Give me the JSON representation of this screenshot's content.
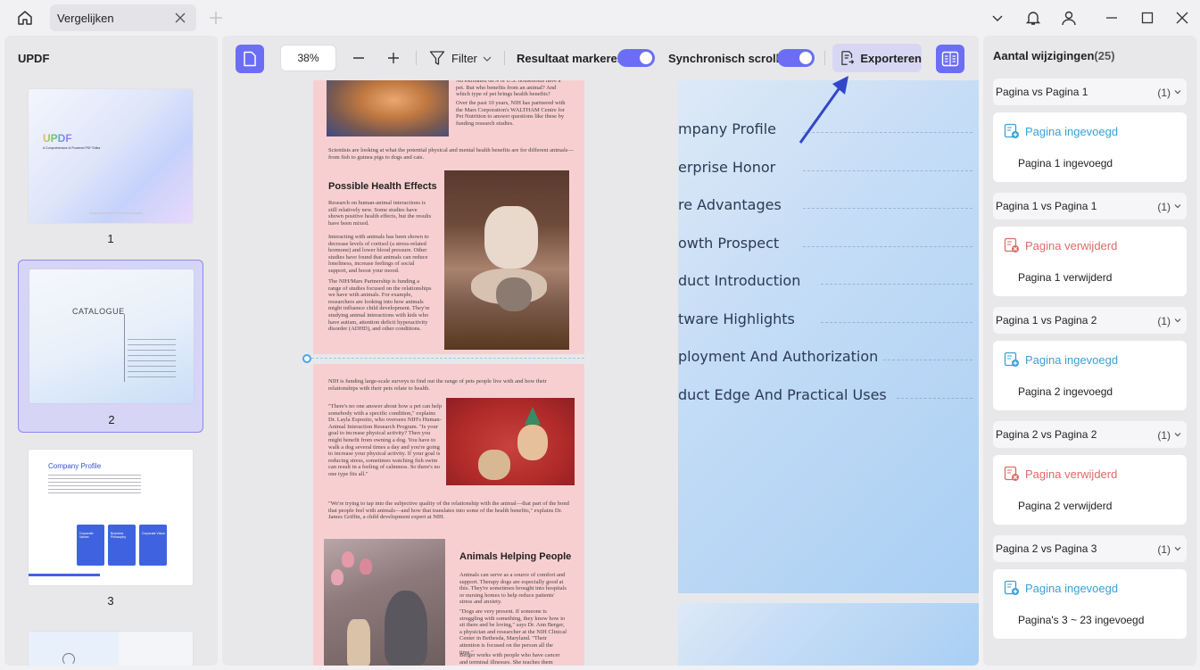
{
  "titlebar": {
    "tab_label": "Vergelijken"
  },
  "left_panel": {
    "title": "UPDF",
    "thumbnails": [
      {
        "number": "1",
        "logo": "UPDF",
        "subtitle": "A Comprehensive AI Powered PDF Editor"
      },
      {
        "number": "2",
        "heading": "CATALOGUE"
      },
      {
        "number": "3",
        "heading": "Company Profile",
        "cards": [
          "Corporate Values",
          "Business Philosophy",
          "Corporate Vision"
        ]
      }
    ]
  },
  "toolbar": {
    "zoom": "38%",
    "filter_label": "Filter",
    "highlight_label": "Resultaat markeren",
    "sync_label": "Synchronisch scrollen",
    "export_label": "Exporteren"
  },
  "left_document": {
    "page1": {
      "intro_top": "An estimated 68% of U.S. households have a pet. But who benefits from an animal? And which type of pet brings health benefits?",
      "intro_2": "Over the past 10 years, NIH has partnered with the Mars Corporation's WALTHAM Centre for Pet Nutrition to answer questions like these by funding research studies.",
      "intro_3": "Scientists are looking at what the potential physical and mental health benefits are for different animals—from fish to guinea pigs to dogs and cats.",
      "heading": "Possible Health Effects",
      "p1": "Research on human-animal interactions is still relatively new. Some studies have shown positive health effects, but the results have been mixed.",
      "p2": "Interacting with animals has been shown to decrease levels of cortisol (a stress-related hormone) and lower blood pressure. Other studies have found that animals can reduce loneliness, increase feelings of social support, and boost your mood.",
      "p3": "The NIH/Mars Partnership is funding a range of studies focused on the relationships we have with animals. For example, researchers are looking into how animals might influence child development. They're studying animal interactions with kids who have autism, attention deficit hyperactivity disorder (ADHD), and other conditions."
    },
    "page2": {
      "p1": "NIH is funding large-scale surveys to find out the range of pets people live with and how their relationships with their pets relate to health.",
      "p2": "\"There's no one answer about how a pet can help somebody with a specific condition,\" explains Dr. Layla Esposito, who oversees NIH's Human-Animal Interaction Research Program. \"Is your goal to increase physical activity? Then you might benefit from owning a dog. You have to walk a dog several times a day and you're going to increase your physical activity. If your goal is reducing stress, sometimes watching fish swim can result in a feeling of calmness. So there's no one type fits all.\"",
      "p3": "\"We're trying to tap into the subjective quality of the relationship with the animal—that part of the bond that people feel with animals—and how that translates into some of the health benefits,\" explains Dr. James Griffin, a child development expert at NIH.",
      "heading": "Animals Helping People",
      "p4": "Animals can serve as a source of comfort and support. Therapy dogs are especially good at this. They're sometimes brought into hospitals or nursing homes to help reduce patients' stress and anxiety.",
      "p5": "\"Dogs are very present. If someone is struggling with something, they know how to sit there and be loving,\" says Dr. Ann Berger, a physician and researcher at the NIH Clinical Center in Bethesda, Maryland. \"Their attention is focused on the person all the time.\"",
      "p6": "Berger works with people who have cancer and terminal illnesses. She teaches them"
    }
  },
  "right_document": {
    "toc": [
      "mpany Profile",
      "erprise Honor",
      "re Advantages",
      "owth Prospect",
      "duct Introduction",
      "tware Highlights",
      "ployment And Authorization",
      "duct Edge And Practical Uses"
    ]
  },
  "right_panel": {
    "title": "Aantal wijzigingen",
    "count": "(25)",
    "groups": [
      {
        "label": "Pagina  vs Pagina 1",
        "num": "(1)",
        "type": "Pagina ingevoegd",
        "kind": "added",
        "detail": "Pagina 1 ingevoegd"
      },
      {
        "label": "Pagina 1 vs Pagina 1",
        "num": "(1)",
        "type": "Pagina verwijderd",
        "kind": "removed",
        "detail": "Pagina 1 verwijderd"
      },
      {
        "label": "Pagina 1 vs Pagina 2",
        "num": "(1)",
        "type": "Pagina ingevoegd",
        "kind": "added",
        "detail": "Pagina 2 ingevoegd"
      },
      {
        "label": "Pagina 2 vs Pagina 2",
        "num": "(1)",
        "type": "Pagina verwijderd",
        "kind": "removed",
        "detail": "Pagina 2 verwijderd"
      },
      {
        "label": "Pagina 2 vs Pagina 3",
        "num": "(1)",
        "type": "Pagina ingevoegd",
        "kind": "added",
        "detail": "Pagina's 3 ~ 23 ingevoegd"
      }
    ]
  },
  "colors": {
    "accent": "#6b6ef4",
    "added": "#3aa0d6",
    "removed": "#e06a6a",
    "highlight_page": "#f8cfd1"
  }
}
